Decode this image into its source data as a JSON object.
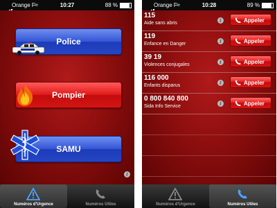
{
  "left": {
    "status": {
      "carrier": "Orange F",
      "time": "10:27",
      "battery": "88 %",
      "battery_level": 0.88
    },
    "buttons": {
      "police": "Police",
      "pompier": "Pompier",
      "samu": "SAMU"
    },
    "tabs": {
      "urgence": "Numéros d'Urgence",
      "utiles": "Numéros Utiles"
    },
    "active_tab": "urgence"
  },
  "right": {
    "status": {
      "carrier": "Orange F",
      "time": "10:28",
      "battery": "89 %",
      "battery_level": 0.89
    },
    "contacts": [
      {
        "number": "115",
        "label": "Aide sans abris",
        "call_label": "Appeler"
      },
      {
        "number": "119",
        "label": "Enfance en Danger",
        "call_label": "Appeler"
      },
      {
        "number": "39 19",
        "label": "Violences conjugales",
        "call_label": "Appeler"
      },
      {
        "number": "116 000",
        "label": "Enfants disparus",
        "call_label": "Appeler"
      },
      {
        "number": "0 800 840 800",
        "label": "Sida Info Service",
        "call_label": "Appeler"
      }
    ],
    "tabs": {
      "urgence": "Numéros d'Urgence",
      "utiles": "Numéros Utiles"
    },
    "active_tab": "utiles"
  },
  "colors": {
    "accent_red": "#e01818",
    "accent_blue": "#3354d6",
    "background": "#8d0e0e"
  },
  "icons": {
    "info": "info-icon",
    "phone": "phone-icon",
    "warning": "warning-triangle-icon",
    "police": "police-car-icon",
    "fire": "fire-icon",
    "medical": "star-of-life-icon"
  }
}
